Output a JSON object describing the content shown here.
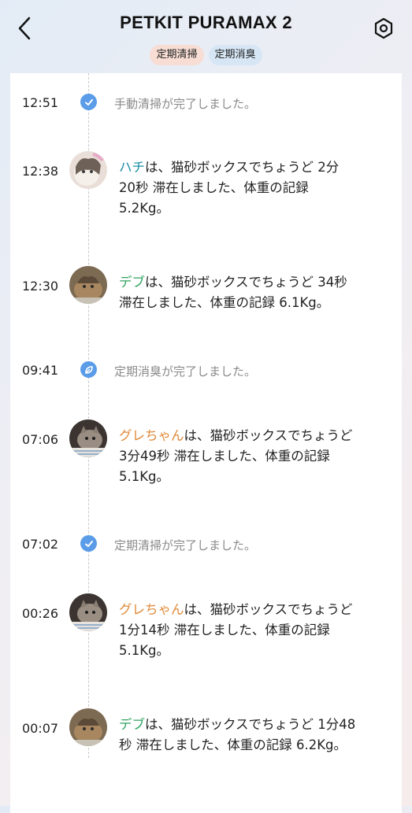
{
  "header": {
    "title": "PETKIT PURAMAX 2",
    "tags": [
      "定期清掃",
      "定期消臭"
    ],
    "icons": {
      "back": "chevron-left-icon",
      "settings": "settings-icon"
    }
  },
  "colors": {
    "accent_blue": "#5b9ce9",
    "name_teal": "#1b8fa6",
    "name_green": "#2fa35f",
    "name_orange": "#e08a3a"
  },
  "events": [
    {
      "time": "12:51",
      "type": "system",
      "icon": "check-icon",
      "text": "手動清掃が完了しました。"
    },
    {
      "time": "12:38",
      "type": "cat",
      "cat": "ハチ",
      "line1": "は、猫砂ボックスでちょうど 2分",
      "line2": "20秒 滞在しました、体重の記録",
      "line3": "5.2Kg。"
    },
    {
      "time": "12:30",
      "type": "cat",
      "cat": "デブ",
      "line1": "は、猫砂ボックスでちょうど 34秒",
      "line2": "滞在しました、体重の記録 6.1Kg。",
      "line3": ""
    },
    {
      "time": "09:41",
      "type": "system",
      "icon": "leaf-icon",
      "text": "定期消臭が完了しました。"
    },
    {
      "time": "07:06",
      "type": "cat",
      "cat": "グレちゃん",
      "line1": "は、猫砂ボックスでちょうど",
      "line2": "3分49秒 滞在しました、体重の記録",
      "line3": "5.1Kg。"
    },
    {
      "time": "07:02",
      "type": "system",
      "icon": "check-icon",
      "text": "定期清掃が完了しました。"
    },
    {
      "time": "00:26",
      "type": "cat",
      "cat": "グレちゃん",
      "line1": "は、猫砂ボックスでちょうど",
      "line2": "1分14秒 滞在しました、体重の記録",
      "line3": "5.1Kg。"
    },
    {
      "time": "00:07",
      "type": "cat",
      "cat": "デブ",
      "line1": "は、猫砂ボックスでちょうど 1分48",
      "line2": "秒 滞在しました、体重の記録 6.2Kg。",
      "line3": ""
    }
  ]
}
